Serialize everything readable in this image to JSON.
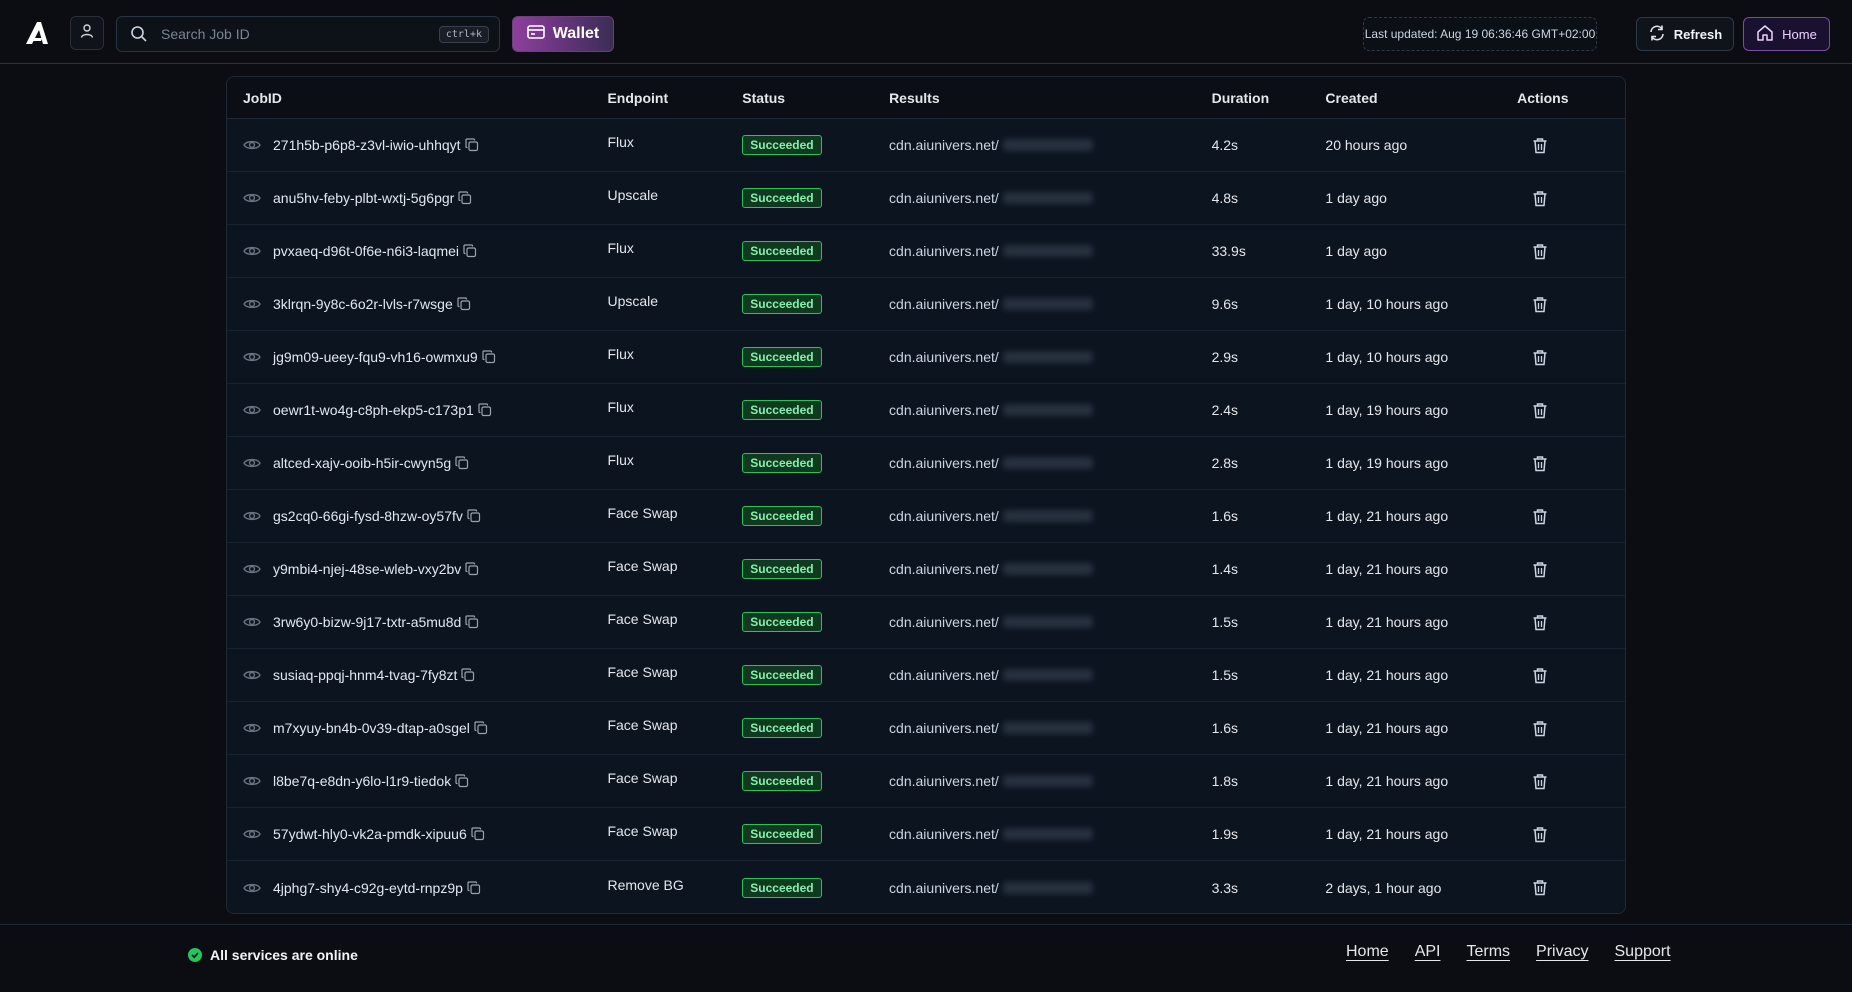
{
  "header": {
    "logo_icon": "aiunivers-logo-icon",
    "user_icon": "user-icon",
    "search": {
      "placeholder": "Search Job ID",
      "value": "",
      "shortcut": "ctrl+k"
    },
    "wallet_label": "Wallet",
    "last_updated": "Last updated: Aug 19 06:36:46 GMT+02:00",
    "refresh_label": "Refresh",
    "home_label": "Home"
  },
  "table": {
    "columns": [
      "JobID",
      "Endpoint",
      "Status",
      "Results",
      "Duration",
      "Created",
      "Actions"
    ],
    "rows": [
      {
        "job_id": "271h5b-p6p8-z3vl-iwio-uhhqyt",
        "endpoint": "Flux",
        "status": "Succeeded",
        "result_host": "cdn.aiunivers.net/",
        "duration": "4.2s",
        "created": "20 hours ago"
      },
      {
        "job_id": "anu5hv-feby-plbt-wxtj-5g6pgr",
        "endpoint": "Upscale",
        "status": "Succeeded",
        "result_host": "cdn.aiunivers.net/",
        "duration": "4.8s",
        "created": "1 day ago"
      },
      {
        "job_id": "pvxaeq-d96t-0f6e-n6i3-laqmei",
        "endpoint": "Flux",
        "status": "Succeeded",
        "result_host": "cdn.aiunivers.net/",
        "duration": "33.9s",
        "created": "1 day ago"
      },
      {
        "job_id": "3klrqn-9y8c-6o2r-lvls-r7wsge",
        "endpoint": "Upscale",
        "status": "Succeeded",
        "result_host": "cdn.aiunivers.net/",
        "duration": "9.6s",
        "created": "1 day, 10 hours ago"
      },
      {
        "job_id": "jg9m09-ueey-fqu9-vh16-owmxu9",
        "endpoint": "Flux",
        "status": "Succeeded",
        "result_host": "cdn.aiunivers.net/",
        "duration": "2.9s",
        "created": "1 day, 10 hours ago"
      },
      {
        "job_id": "oewr1t-wo4g-c8ph-ekp5-c173p1",
        "endpoint": "Flux",
        "status": "Succeeded",
        "result_host": "cdn.aiunivers.net/",
        "duration": "2.4s",
        "created": "1 day, 19 hours ago"
      },
      {
        "job_id": "altced-xajv-ooib-h5ir-cwyn5g",
        "endpoint": "Flux",
        "status": "Succeeded",
        "result_host": "cdn.aiunivers.net/",
        "duration": "2.8s",
        "created": "1 day, 19 hours ago"
      },
      {
        "job_id": "gs2cq0-66gi-fysd-8hzw-oy57fv",
        "endpoint": "Face Swap",
        "status": "Succeeded",
        "result_host": "cdn.aiunivers.net/",
        "duration": "1.6s",
        "created": "1 day, 21 hours ago"
      },
      {
        "job_id": "y9mbi4-njej-48se-wleb-vxy2bv",
        "endpoint": "Face Swap",
        "status": "Succeeded",
        "result_host": "cdn.aiunivers.net/",
        "duration": "1.4s",
        "created": "1 day, 21 hours ago"
      },
      {
        "job_id": "3rw6y0-bizw-9j17-txtr-a5mu8d",
        "endpoint": "Face Swap",
        "status": "Succeeded",
        "result_host": "cdn.aiunivers.net/",
        "duration": "1.5s",
        "created": "1 day, 21 hours ago"
      },
      {
        "job_id": "susiaq-ppqj-hnm4-tvag-7fy8zt",
        "endpoint": "Face Swap",
        "status": "Succeeded",
        "result_host": "cdn.aiunivers.net/",
        "duration": "1.5s",
        "created": "1 day, 21 hours ago"
      },
      {
        "job_id": "m7xyuy-bn4b-0v39-dtap-a0sgel",
        "endpoint": "Face Swap",
        "status": "Succeeded",
        "result_host": "cdn.aiunivers.net/",
        "duration": "1.6s",
        "created": "1 day, 21 hours ago"
      },
      {
        "job_id": "l8be7q-e8dn-y6lo-l1r9-tiedok",
        "endpoint": "Face Swap",
        "status": "Succeeded",
        "result_host": "cdn.aiunivers.net/",
        "duration": "1.8s",
        "created": "1 day, 21 hours ago"
      },
      {
        "job_id": "57ydwt-hly0-vk2a-pmdk-xipuu6",
        "endpoint": "Face Swap",
        "status": "Succeeded",
        "result_host": "cdn.aiunivers.net/",
        "duration": "1.9s",
        "created": "1 day, 21 hours ago"
      },
      {
        "job_id": "4jphg7-shy4-c92g-eytd-rnpz9p",
        "endpoint": "Remove BG",
        "status": "Succeeded",
        "result_host": "cdn.aiunivers.net/",
        "duration": "3.3s",
        "created": "2 days, 1 hour ago"
      }
    ]
  },
  "footer": {
    "status_text": "All services are online",
    "links": [
      "Home",
      "API",
      "Terms",
      "Privacy",
      "Support"
    ]
  },
  "colors": {
    "background": "#0b0d12",
    "success": "#22c55e",
    "wallet_accent": "#8e3f9c",
    "home_accent": "#7a4ca0"
  }
}
